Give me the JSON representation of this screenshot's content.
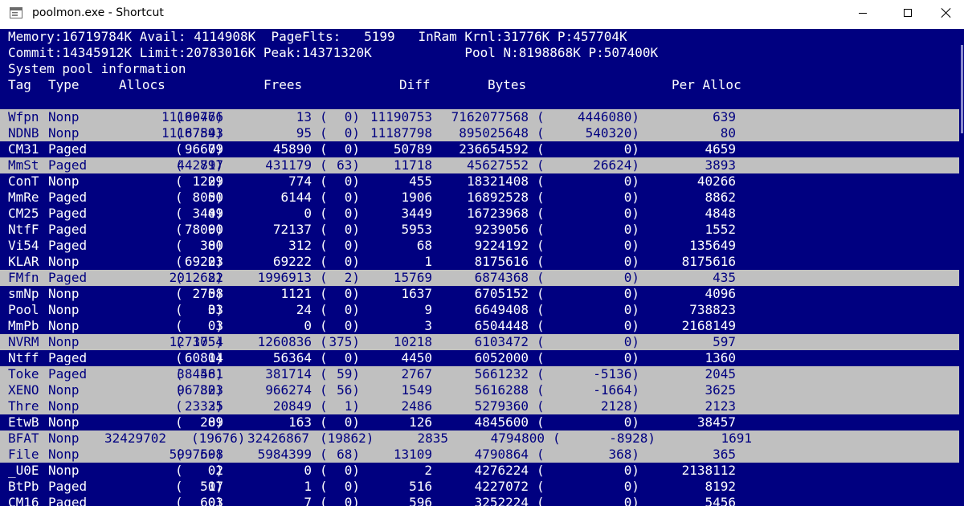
{
  "window": {
    "title": "poolmon.exe - Shortcut",
    "icon": "console-app-icon"
  },
  "colors": {
    "console_bg": "#000080",
    "console_fg": "#ffffff",
    "highlight_bg": "#c0c0c0",
    "highlight_fg": "#000080"
  },
  "header": {
    "line1": "Memory:16719784K Avail: 4114908K  PageFlts:   5199   InRam Krnl:31776K P:457704K",
    "line2": "Commit:14345912K Limit:20783016K Peak:14371320K            Pool N:8198868K P:507400K",
    "line3": "System pool information"
  },
  "columns": [
    "Tag",
    "Type",
    "Allocs",
    "Frees",
    "Diff",
    "Bytes",
    "Per Alloc"
  ],
  "rows": [
    {
      "tag": "Wfpn",
      "type": "Nonp",
      "allocs": "11190766",
      "allocs_d": "6947",
      "frees": "13",
      "frees_d": "0",
      "diff": "11190753",
      "bytes": "7162077568",
      "bytes_d": "4446080",
      "per": "639",
      "hl": true
    },
    {
      "tag": "NDNB",
      "type": "Nonp",
      "allocs": "11187893",
      "allocs_d": "6754",
      "frees": "95",
      "frees_d": "0",
      "diff": "11187798",
      "bytes": "895025648",
      "bytes_d": "540320",
      "per": "80",
      "hl": true
    },
    {
      "tag": "CM31",
      "type": "Paged",
      "allocs": "96679",
      "allocs_d": "0",
      "frees": "45890",
      "frees_d": "0",
      "diff": "50789",
      "bytes": "236654592",
      "bytes_d": "0",
      "per": "4659",
      "hl": false
    },
    {
      "tag": "MmSt",
      "type": "Paged",
      "allocs": "442897",
      "allocs_d": "71",
      "frees": "431179",
      "frees_d": "63",
      "diff": "11718",
      "bytes": "45627552",
      "bytes_d": "26624",
      "per": "3893",
      "hl": true
    },
    {
      "tag": "ConT",
      "type": "Nonp",
      "allocs": "1229",
      "allocs_d": "0",
      "frees": "774",
      "frees_d": "0",
      "diff": "455",
      "bytes": "18321408",
      "bytes_d": "0",
      "per": "40266",
      "hl": false
    },
    {
      "tag": "MmRe",
      "type": "Paged",
      "allocs": "8050",
      "allocs_d": "0",
      "frees": "6144",
      "frees_d": "0",
      "diff": "1906",
      "bytes": "16892528",
      "bytes_d": "0",
      "per": "8862",
      "hl": false
    },
    {
      "tag": "CM25",
      "type": "Paged",
      "allocs": "3449",
      "allocs_d": "0",
      "frees": "0",
      "frees_d": "0",
      "diff": "3449",
      "bytes": "16723968",
      "bytes_d": "0",
      "per": "4848",
      "hl": false
    },
    {
      "tag": "NtfF",
      "type": "Paged",
      "allocs": "78090",
      "allocs_d": "0",
      "frees": "72137",
      "frees_d": "0",
      "diff": "5953",
      "bytes": "9239056",
      "bytes_d": "0",
      "per": "1552",
      "hl": false
    },
    {
      "tag": "Vi54",
      "type": "Paged",
      "allocs": "380",
      "allocs_d": "0",
      "frees": "312",
      "frees_d": "0",
      "diff": "68",
      "bytes": "9224192",
      "bytes_d": "0",
      "per": "135649",
      "hl": false
    },
    {
      "tag": "KLAR",
      "type": "Nonp",
      "allocs": "69223",
      "allocs_d": "0",
      "frees": "69222",
      "frees_d": "0",
      "diff": "1",
      "bytes": "8175616",
      "bytes_d": "0",
      "per": "8175616",
      "hl": false
    },
    {
      "tag": "FMfn",
      "type": "Paged",
      "allocs": "2012682",
      "allocs_d": "2",
      "frees": "1996913",
      "frees_d": "2",
      "diff": "15769",
      "bytes": "6874368",
      "bytes_d": "0",
      "per": "435",
      "hl": true
    },
    {
      "tag": "smNp",
      "type": "Nonp",
      "allocs": "2758",
      "allocs_d": "0",
      "frees": "1121",
      "frees_d": "0",
      "diff": "1637",
      "bytes": "6705152",
      "bytes_d": "0",
      "per": "4096",
      "hl": false
    },
    {
      "tag": "Pool",
      "type": "Nonp",
      "allocs": "33",
      "allocs_d": "0",
      "frees": "24",
      "frees_d": "0",
      "diff": "9",
      "bytes": "6649408",
      "bytes_d": "0",
      "per": "738823",
      "hl": false
    },
    {
      "tag": "MmPb",
      "type": "Nonp",
      "allocs": "3",
      "allocs_d": "0",
      "frees": "0",
      "frees_d": "0",
      "diff": "3",
      "bytes": "6504448",
      "bytes_d": "0",
      "per": "2168149",
      "hl": false
    },
    {
      "tag": "NVRM",
      "type": "Nonp",
      "allocs": "1271054",
      "allocs_d": "375",
      "frees": "1260836",
      "frees_d": "375",
      "diff": "10218",
      "bytes": "6103472",
      "bytes_d": "0",
      "per": "597",
      "hl": true
    },
    {
      "tag": "Ntff",
      "type": "Paged",
      "allocs": "60814",
      "allocs_d": "0",
      "frees": "56364",
      "frees_d": "0",
      "diff": "4450",
      "bytes": "6052000",
      "bytes_d": "0",
      "per": "1360",
      "hl": false
    },
    {
      "tag": "Toke",
      "type": "Paged",
      "allocs": "384481",
      "allocs_d": "56",
      "frees": "381714",
      "frees_d": "59",
      "diff": "2767",
      "bytes": "5661232",
      "bytes_d": "-5136",
      "per": "2045",
      "hl": true
    },
    {
      "tag": "XENO",
      "type": "Nonp",
      "allocs": "967823",
      "allocs_d": "30",
      "frees": "966274",
      "frees_d": "56",
      "diff": "1549",
      "bytes": "5616288",
      "bytes_d": "-1664",
      "per": "3625",
      "hl": true
    },
    {
      "tag": "Thre",
      "type": "Nonp",
      "allocs": "23335",
      "allocs_d": "2",
      "frees": "20849",
      "frees_d": "1",
      "diff": "2486",
      "bytes": "5279360",
      "bytes_d": "2128",
      "per": "2123",
      "hl": true
    },
    {
      "tag": "EtwB",
      "type": "Nonp",
      "allocs": "289",
      "allocs_d": "0",
      "frees": "163",
      "frees_d": "0",
      "diff": "126",
      "bytes": "4845600",
      "bytes_d": "0",
      "per": "38457",
      "hl": false
    },
    {
      "tag": "BFAT",
      "type": "Nonp",
      "allocs": "32429702",
      "allocs_d": "19676",
      "frees": "32426867",
      "frees_d": "19862",
      "diff": "2835",
      "bytes": "4794800",
      "bytes_d": "-8928",
      "per": "1691",
      "hl": true,
      "wide": true
    },
    {
      "tag": "File",
      "type": "Nonp",
      "allocs": "5997508",
      "allocs_d": "69",
      "frees": "5984399",
      "frees_d": "68",
      "diff": "13109",
      "bytes": "4790864",
      "bytes_d": "368",
      "per": "365",
      "hl": true
    },
    {
      "tag": "_U0E",
      "type": "Nonp",
      "allocs": "2",
      "allocs_d": "0",
      "frees": "0",
      "frees_d": "0",
      "diff": "2",
      "bytes": "4276224",
      "bytes_d": "0",
      "per": "2138112",
      "hl": false
    },
    {
      "tag": "BtPb",
      "type": "Paged",
      "allocs": "517",
      "allocs_d": "0",
      "frees": "1",
      "frees_d": "0",
      "diff": "516",
      "bytes": "4227072",
      "bytes_d": "0",
      "per": "8192",
      "hl": false
    },
    {
      "tag": "CM16",
      "type": "Paged",
      "allocs": "603",
      "allocs_d": "0",
      "frees": "7",
      "frees_d": "0",
      "diff": "596",
      "bytes": "3252224",
      "bytes_d": "0",
      "per": "5456",
      "hl": false
    }
  ]
}
